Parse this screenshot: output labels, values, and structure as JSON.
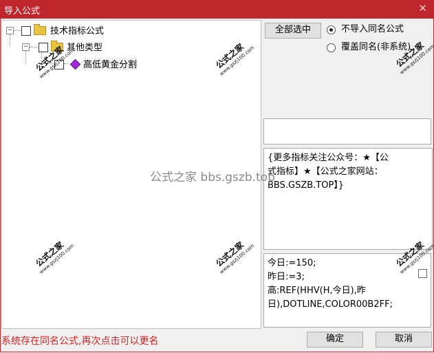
{
  "window": {
    "title": "导入公式",
    "close_glyph": "✕"
  },
  "tree": {
    "root_label": "技术指标公式",
    "group_label": "其他类型",
    "item_label": "高低黄金分割",
    "expander_glyph": "−"
  },
  "options": {
    "select_all_label": "全部选中",
    "radio_skip_label": "不导入同名公式",
    "radio_overwrite_label": "覆盖同名(非系统)",
    "selected_radio": "skip"
  },
  "description": {
    "lines": "{更多指标关注公众号：★【公\n式指标】★【公式之家网站：\nBBS.GSZB.TOP】}"
  },
  "code": {
    "lines": "今日:=150;\n昨日:=3;\n高:REF(HHV(H,今日),昨\n日),DOTLINE,COLOR00B2FF;"
  },
  "status": {
    "message": "系统存在同名公式,再次点击可以更名"
  },
  "buttons": {
    "ok_label": "确定",
    "cancel_label": "取消"
  },
  "watermark": {
    "center_text": "公式之家 bbs.gszb.top",
    "stamp_big": "公式之家",
    "stamp_small": "www.gszj100.com"
  },
  "colors": {
    "titlebar": "#c0272d",
    "status_text": "#e02020",
    "item_icon": "#a12ad6"
  }
}
